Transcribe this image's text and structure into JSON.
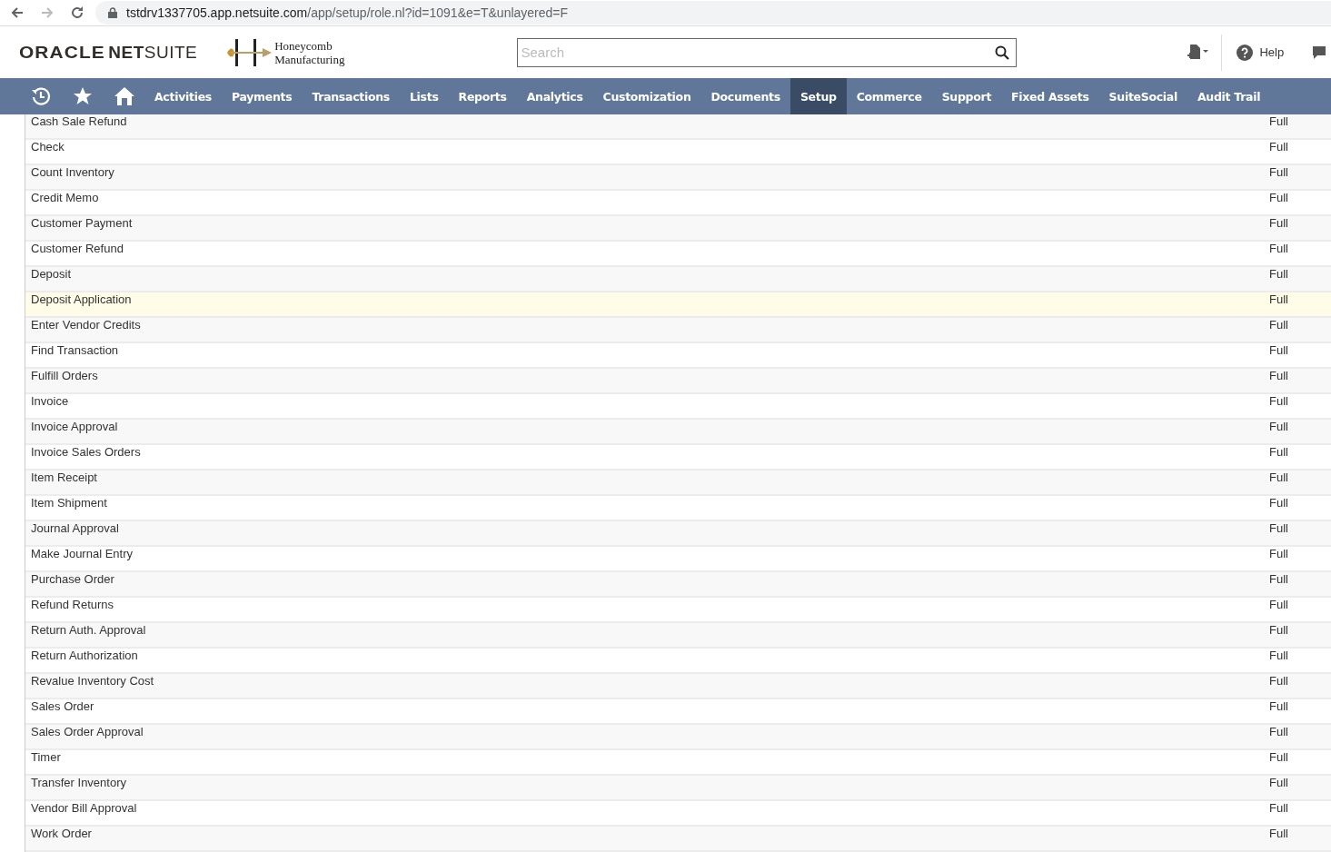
{
  "browser": {
    "url_host": "tstdrv1337705.app.netsuite.com",
    "url_path": "/app/setup/role.nl?id=1091&e=T&unlayered=F"
  },
  "header": {
    "logo_word": "ORACLE",
    "logo_product": "**NET**SUITE",
    "company_lines": [
      "Honeycomb",
      "Manufacturing"
    ],
    "search": {
      "placeholder": "Search"
    },
    "help_label": "Help"
  },
  "nav": {
    "tabs": [
      {
        "label": "Activities",
        "selected": false
      },
      {
        "label": "Payments",
        "selected": false
      },
      {
        "label": "Transactions",
        "selected": false
      },
      {
        "label": "Lists",
        "selected": false
      },
      {
        "label": "Reports",
        "selected": false
      },
      {
        "label": "Analytics",
        "selected": false
      },
      {
        "label": "Customization",
        "selected": false
      },
      {
        "label": "Documents",
        "selected": false
      },
      {
        "label": "Setup",
        "selected": true
      },
      {
        "label": "Commerce",
        "selected": false
      },
      {
        "label": "Support",
        "selected": false
      },
      {
        "label": "Fixed Assets",
        "selected": false
      },
      {
        "label": "SuiteSocial",
        "selected": false
      },
      {
        "label": "Audit Trail",
        "selected": false
      }
    ]
  },
  "table": {
    "rows": [
      {
        "permission": "Cash Sale Refund",
        "level": "Full",
        "highlighted": false
      },
      {
        "permission": "Check",
        "level": "Full",
        "highlighted": false
      },
      {
        "permission": "Count Inventory",
        "level": "Full",
        "highlighted": false
      },
      {
        "permission": "Credit Memo",
        "level": "Full",
        "highlighted": false
      },
      {
        "permission": "Customer Payment",
        "level": "Full",
        "highlighted": false
      },
      {
        "permission": "Customer Refund",
        "level": "Full",
        "highlighted": false
      },
      {
        "permission": "Deposit",
        "level": "Full",
        "highlighted": false
      },
      {
        "permission": "Deposit Application",
        "level": "Full",
        "highlighted": true
      },
      {
        "permission": "Enter Vendor Credits",
        "level": "Full",
        "highlighted": false
      },
      {
        "permission": "Find Transaction",
        "level": "Full",
        "highlighted": false
      },
      {
        "permission": "Fulfill Orders",
        "level": "Full",
        "highlighted": false
      },
      {
        "permission": "Invoice",
        "level": "Full",
        "highlighted": false
      },
      {
        "permission": "Invoice Approval",
        "level": "Full",
        "highlighted": false
      },
      {
        "permission": "Invoice Sales Orders",
        "level": "Full",
        "highlighted": false
      },
      {
        "permission": "Item Receipt",
        "level": "Full",
        "highlighted": false
      },
      {
        "permission": "Item Shipment",
        "level": "Full",
        "highlighted": false
      },
      {
        "permission": "Journal Approval",
        "level": "Full",
        "highlighted": false
      },
      {
        "permission": "Make Journal Entry",
        "level": "Full",
        "highlighted": false
      },
      {
        "permission": "Purchase Order",
        "level": "Full",
        "highlighted": false
      },
      {
        "permission": "Refund Returns",
        "level": "Full",
        "highlighted": false
      },
      {
        "permission": "Return Auth. Approval",
        "level": "Full",
        "highlighted": false
      },
      {
        "permission": "Return Authorization",
        "level": "Full",
        "highlighted": false
      },
      {
        "permission": "Revalue Inventory Cost",
        "level": "Full",
        "highlighted": false
      },
      {
        "permission": "Sales Order",
        "level": "Full",
        "highlighted": false
      },
      {
        "permission": "Sales Order Approval",
        "level": "Full",
        "highlighted": false
      },
      {
        "permission": "Timer",
        "level": "Full",
        "highlighted": false
      },
      {
        "permission": "Transfer Inventory",
        "level": "Full",
        "highlighted": false
      },
      {
        "permission": "Vendor Bill Approval",
        "level": "Full",
        "highlighted": false
      },
      {
        "permission": "Work Order",
        "level": "Full",
        "highlighted": false
      }
    ]
  }
}
